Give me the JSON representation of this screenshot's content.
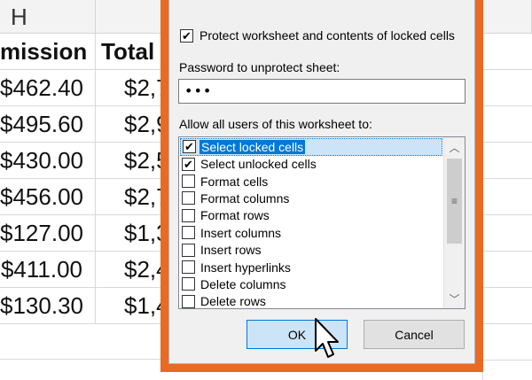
{
  "spreadsheet": {
    "column_letter": "H",
    "headers": [
      "mission",
      "Total"
    ],
    "rows": [
      [
        "$462.40",
        "$2,7"
      ],
      [
        "$495.60",
        "$2,9"
      ],
      [
        "$430.00",
        "$2,5"
      ],
      [
        "$456.00",
        "$2,7"
      ],
      [
        "$127.00",
        "$1,3"
      ],
      [
        "$411.00",
        "$2,4"
      ],
      [
        "$130.30",
        "$1,4"
      ]
    ]
  },
  "dialog": {
    "protect_label": "Protect worksheet and contents of locked cells",
    "protect_checked": true,
    "password_label": "Password to unprotect sheet:",
    "password_value": "•••",
    "allow_label": "Allow all users of this worksheet to:",
    "permissions": [
      {
        "label": "Select locked cells",
        "checked": "✔"
      },
      {
        "label": "Select unlocked cells",
        "checked": "✔"
      },
      {
        "label": "Format cells",
        "checked": ""
      },
      {
        "label": "Format columns",
        "checked": ""
      },
      {
        "label": "Format rows",
        "checked": ""
      },
      {
        "label": "Insert columns",
        "checked": ""
      },
      {
        "label": "Insert rows",
        "checked": ""
      },
      {
        "label": "Insert hyperlinks",
        "checked": ""
      },
      {
        "label": "Delete columns",
        "checked": ""
      },
      {
        "label": "Delete rows",
        "checked": ""
      }
    ],
    "ok_label": "OK",
    "cancel_label": "Cancel",
    "check_glyph": "✔",
    "scroll_up_glyph": "︿",
    "scroll_down_glyph": "﹀",
    "thumb_glyph": "≡"
  },
  "colors": {
    "accent_border": "#e96a23",
    "selection": "#0078d7"
  }
}
